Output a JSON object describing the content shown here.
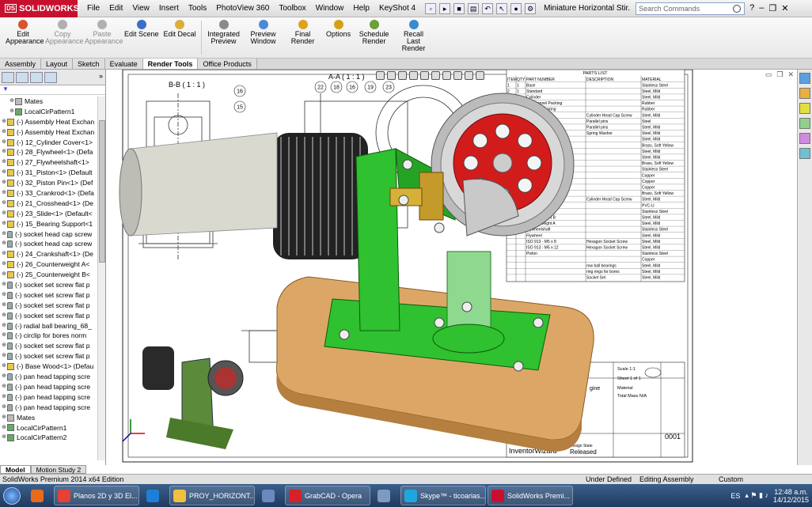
{
  "app": {
    "name": "SOLIDWORKS",
    "doc_title": "Miniature Horizontal Stir..."
  },
  "menu": [
    "File",
    "Edit",
    "View",
    "Insert",
    "Tools",
    "PhotoView 360",
    "Toolbox",
    "Window",
    "Help",
    "KeyShot 4"
  ],
  "search": {
    "placeholder": "Search Commands"
  },
  "ribbon": [
    {
      "label": "Edit Appearance",
      "disabled": false,
      "color": "#d9542b"
    },
    {
      "label": "Copy Appearance",
      "disabled": true,
      "color": "#b0b0b0"
    },
    {
      "label": "Paste Appearance",
      "disabled": true,
      "color": "#b0b0b0"
    },
    {
      "label": "Edit Scene",
      "disabled": false,
      "color": "#3a6ec9"
    },
    {
      "label": "Edit Decal",
      "disabled": false,
      "color": "#d8b03a"
    },
    {
      "label": "Integrated Preview",
      "disabled": false,
      "color": "#8a8a8a"
    },
    {
      "label": "Preview Window",
      "disabled": false,
      "color": "#4b8ad6"
    },
    {
      "label": "Final Render",
      "disabled": false,
      "color": "#e0a020"
    },
    {
      "label": "Options",
      "disabled": false,
      "color": "#d4a017"
    },
    {
      "label": "Schedule Render",
      "disabled": false,
      "color": "#6a9f3a"
    },
    {
      "label": "Recall Last Render",
      "disabled": false,
      "color": "#3a8ad0"
    }
  ],
  "tabs": [
    {
      "label": "Assembly",
      "active": false
    },
    {
      "label": "Layout",
      "active": false
    },
    {
      "label": "Sketch",
      "active": false
    },
    {
      "label": "Evaluate",
      "active": false
    },
    {
      "label": "Render Tools",
      "active": true
    },
    {
      "label": "Office Products",
      "active": false
    }
  ],
  "feature_tree": [
    {
      "label": "Mates",
      "icon": "mates",
      "indent": 1
    },
    {
      "label": "LocalCirPattern1",
      "icon": "pattern",
      "indent": 1
    },
    {
      "label": "(-) Assembly Heat Exchan",
      "icon": "part",
      "indent": 0
    },
    {
      "label": "(-) Assembly Heat Exchan",
      "icon": "part",
      "indent": 0
    },
    {
      "label": "(-) 12_Cylinder Cover<1>",
      "icon": "part",
      "indent": 0
    },
    {
      "label": "(-) 28_Flywheel<1> (Defa",
      "icon": "part",
      "indent": 0
    },
    {
      "label": "(-) 27_Flywheelshaft<1>",
      "icon": "part",
      "indent": 0
    },
    {
      "label": "(-) 31_Piston<1> (Default",
      "icon": "part",
      "indent": 0
    },
    {
      "label": "(-) 32_Piston Pin<1> (Def",
      "icon": "part",
      "indent": 0
    },
    {
      "label": "(-) 33_Crankrod<1> (Defa",
      "icon": "part",
      "indent": 0
    },
    {
      "label": "(-) 21_Crosshead<1> (De",
      "icon": "part",
      "indent": 0
    },
    {
      "label": "(-) 23_Slide<1> (Default<",
      "icon": "part",
      "indent": 0
    },
    {
      "label": "(-) 15_Bearing Support<1",
      "icon": "part",
      "indent": 0
    },
    {
      "label": "(-) socket head cap screw",
      "icon": "screw",
      "indent": 0
    },
    {
      "label": "(-) socket head cap screw",
      "icon": "screw",
      "indent": 0
    },
    {
      "label": "(-) 24_Crankshaft<1> (De",
      "icon": "part",
      "indent": 0
    },
    {
      "label": "(-) 26_Counterweight A<",
      "icon": "part",
      "indent": 0
    },
    {
      "label": "(-) 25_Counterweight B<",
      "icon": "part",
      "indent": 0
    },
    {
      "label": "(-) socket set screw flat p",
      "icon": "screw",
      "indent": 0
    },
    {
      "label": "(-) socket set screw flat p",
      "icon": "screw",
      "indent": 0
    },
    {
      "label": "(-) socket set screw flat p",
      "icon": "screw",
      "indent": 0
    },
    {
      "label": "(-) socket set screw flat p",
      "icon": "screw",
      "indent": 0
    },
    {
      "label": "(-) radial ball bearing_68_",
      "icon": "screw",
      "indent": 0
    },
    {
      "label": "(-) circlip for bores norm",
      "icon": "screw",
      "indent": 0
    },
    {
      "label": "(-) socket set screw flat p",
      "icon": "screw",
      "indent": 0
    },
    {
      "label": "(-) socket set screw flat p",
      "icon": "screw",
      "indent": 0
    },
    {
      "label": "(-) Base Wood<1> (Defau",
      "icon": "part",
      "indent": 0
    },
    {
      "label": "(-) pan head tapping scre",
      "icon": "screw",
      "indent": 0
    },
    {
      "label": "(-) pan head tapping scre",
      "icon": "screw",
      "indent": 0
    },
    {
      "label": "(-) pan head tapping scre",
      "icon": "screw",
      "indent": 0
    },
    {
      "label": "(-) pan head tapping scre",
      "icon": "screw",
      "indent": 0
    },
    {
      "label": "Mates",
      "icon": "mates",
      "indent": 0
    },
    {
      "label": "LocalCirPattern1",
      "icon": "pattern",
      "indent": 0
    },
    {
      "label": "LocalCirPattern2",
      "icon": "pattern",
      "indent": 0
    }
  ],
  "bottom_tabs": [
    {
      "label": "Model",
      "active": true
    },
    {
      "label": "Motion Study 2",
      "active": false
    }
  ],
  "drawing": {
    "section_bb": "B-B ( 1 : 1 )",
    "section_aa": "A-A ( 1 : 1 )",
    "parts_list_title": "PARTS LIST",
    "parts_list_headers": [
      "ITEM",
      "QTY",
      "PART NUMBER",
      "DESCRIPTION",
      "MATERIAL"
    ],
    "balloons": [
      "22",
      "18",
      "16",
      "19",
      "23",
      "16",
      "15"
    ],
    "parts_list_rows": [
      [
        "1",
        "1",
        "Base",
        "",
        "Stainless Steel"
      ],
      [
        "2",
        "1",
        "Standard",
        "",
        "Steel, Mild"
      ],
      [
        "3",
        "1",
        "Cylinder",
        "",
        "Steel, Mild"
      ],
      [
        "4",
        "1",
        "Air Channel Packing",
        "",
        "Rubber"
      ],
      [
        "5",
        "1",
        "Cylinder Packing",
        "",
        "Rubber"
      ],
      [
        "",
        "",
        "",
        "Cylinder Head Cap Screw",
        "Steel, Mild"
      ],
      [
        "",
        "",
        "",
        "Parallel pins",
        "Steel"
      ],
      [
        "",
        "",
        "",
        "Parallel pins",
        "Steel, Mild"
      ],
      [
        "",
        "",
        "",
        "Spring Washer",
        "Steel, Mild"
      ],
      [
        "",
        "",
        "",
        "",
        "Steel, Mild"
      ],
      [
        "",
        "",
        "",
        "",
        "Brass, Soft Yellow"
      ],
      [
        "",
        "",
        "",
        "",
        "Steel, Mild"
      ],
      [
        "",
        "",
        "",
        "",
        "Steel, Mild"
      ],
      [
        "",
        "",
        "",
        "",
        "Brass, Soft Yellow"
      ],
      [
        "",
        "",
        "",
        "",
        "Stainless Steel"
      ],
      [
        "",
        "",
        "",
        "",
        "Copper"
      ],
      [
        "",
        "",
        "",
        "",
        "Copper"
      ],
      [
        "",
        "",
        "",
        "",
        "Copper"
      ],
      [
        "",
        "",
        "",
        "",
        "Brass, Soft Yellow"
      ],
      [
        "",
        "",
        "",
        "Cylinder Head Cap Screw",
        "Steel, Mild"
      ],
      [
        "",
        "",
        "",
        "",
        "PVC-U"
      ],
      [
        "",
        "",
        "Crankshaft",
        "",
        "Stainless Steel"
      ],
      [
        "",
        "",
        "Counterweight B",
        "",
        "Steel, Mild"
      ],
      [
        "",
        "",
        "Counterweight A",
        "",
        "Steel, Mild"
      ],
      [
        "",
        "",
        "Flywheelshaft",
        "",
        "Stainless Steel"
      ],
      [
        "",
        "",
        "Flywheel",
        "",
        "Steel, Mild"
      ],
      [
        "",
        "",
        "ISO 913 - M5 x 8",
        "Hexagon Socket Screw",
        "Steel, Mild"
      ],
      [
        "",
        "",
        "ISO 913 - M5 x 12",
        "Hexagon Socket Screw",
        "Steel, Mild"
      ],
      [
        "",
        "",
        "Piston",
        "",
        "Stainless Steel"
      ],
      [
        "",
        "",
        "",
        "",
        "Copper"
      ],
      [
        "",
        "",
        "",
        "row ball bearings",
        "Steel, Mild"
      ],
      [
        "",
        "",
        "",
        "ring rings for bores",
        "Steel, Mild"
      ],
      [
        "",
        "",
        "",
        "Socket Set",
        "Steel, Mild"
      ]
    ],
    "title_block": {
      "scale": "Scale 1:1",
      "sheet": "Sheet 1 of 1",
      "material": "Material",
      "doc_number": "0001",
      "company": "InventorWizard",
      "design_state": "Design State",
      "state_value": "Released",
      "engine": "gine",
      "total_mass": "Total Mass N/A"
    }
  },
  "status_bar": {
    "app": "SolidWorks Premium 2014 x64 Edition",
    "under_defined": "Under Defined",
    "mode": "Editing Assembly",
    "units": "Custom"
  },
  "taskbar": {
    "items": [
      {
        "label": "",
        "color": "#e86a1c"
      },
      {
        "label": "Planos 2D y 3D El...",
        "color": "#e34234",
        "wide": true
      },
      {
        "label": "",
        "color": "#1e7fd8"
      },
      {
        "label": "PROY_HORIZONT...",
        "color": "#f0c040",
        "wide": true
      },
      {
        "label": "",
        "color": "#6a8abd"
      },
      {
        "label": "GrabCAD - Opera",
        "color": "#d6202a",
        "wide": true
      },
      {
        "label": "",
        "color": "#7f9ac0"
      },
      {
        "label": "Skype™ - ticoarias...",
        "color": "#1ea6e0",
        "wide": true
      },
      {
        "label": "SolidWorks Premi...",
        "color": "#c8102e",
        "wide": true
      }
    ],
    "lang": "ES",
    "time": "12:48 a.m.",
    "date": "14/12/2015"
  }
}
